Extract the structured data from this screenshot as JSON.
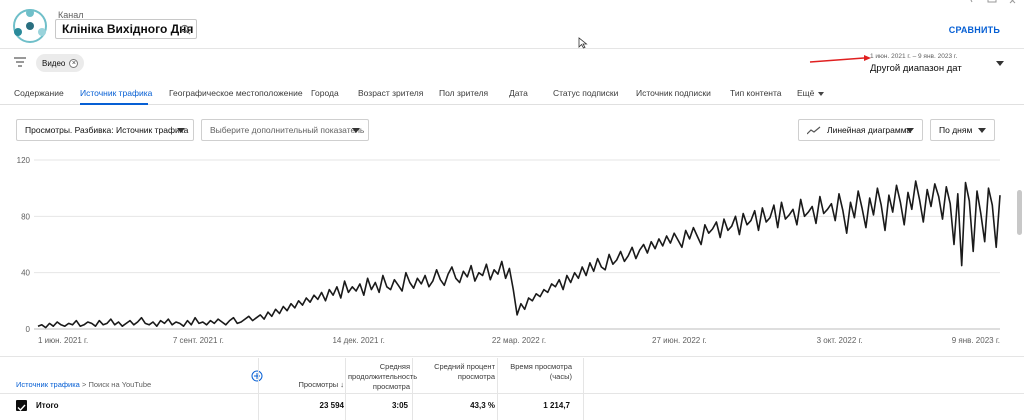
{
  "header": {
    "channel_label": "Канал",
    "channel_name": "Клініка Вихідного Дня",
    "compare": "СРАВНИТЬ"
  },
  "filters": {
    "chip_label": "Видео",
    "date_range": "1 июн. 2021 г. – 9 янв. 2023 г.",
    "date_preset": "Другой диапазон дат"
  },
  "tabs": [
    {
      "label": "Содержание"
    },
    {
      "label": "Источник трафика",
      "active": true
    },
    {
      "label": "Географическое местоположение"
    },
    {
      "label": "Города"
    },
    {
      "label": "Возраст зрителя"
    },
    {
      "label": "Пол зрителя"
    },
    {
      "label": "Дата"
    },
    {
      "label": "Статус подписки"
    },
    {
      "label": "Источник подписки"
    },
    {
      "label": "Тип контента"
    },
    {
      "label": "Ещё"
    }
  ],
  "selectors": {
    "metric": "Просмотры. Разбивка: Источник трафика",
    "extra_metric": "Выберите дополнительный показатель",
    "chart_type": "Линейная диаграмма",
    "interval": "По дням"
  },
  "chart_data": {
    "type": "line",
    "ylim": [
      0,
      120
    ],
    "yticks": [
      "0",
      "40",
      "80",
      "120"
    ],
    "xticks": [
      "1 июн. 2021 г.",
      "7 сент. 2021 г.",
      "14 дек. 2021 г.",
      "22 мар. 2022 г.",
      "27 июн. 2022 г.",
      "3 окт. 2022 г.",
      "9 янв. 2023 г."
    ],
    "series": [
      {
        "color": "#1a1a1a",
        "x_start": "2021-06-01",
        "x_end": "2023-01-09",
        "values": [
          2,
          3,
          1,
          4,
          2,
          5,
          3,
          2,
          4,
          3,
          6,
          2,
          3,
          5,
          4,
          2,
          6,
          3,
          4,
          7,
          3,
          5,
          2,
          4,
          6,
          3,
          5,
          8,
          4,
          3,
          5,
          2,
          6,
          4,
          7,
          3,
          5,
          4,
          2,
          6,
          3,
          8,
          4,
          5,
          3,
          6,
          4,
          7,
          5,
          3,
          6,
          8,
          4,
          5,
          7,
          9,
          6,
          8,
          10,
          7,
          12,
          9,
          14,
          11,
          16,
          13,
          18,
          15,
          20,
          17,
          22,
          19,
          24,
          21,
          26,
          20,
          28,
          24,
          30,
          22,
          34,
          26,
          30,
          27,
          32,
          24,
          36,
          28,
          33,
          26,
          38,
          30,
          28,
          35,
          31,
          27,
          40,
          33,
          29,
          36,
          32,
          38,
          30,
          34,
          42,
          35,
          31,
          39,
          44,
          36,
          33,
          41,
          37,
          45,
          34,
          40,
          38,
          46,
          35,
          42,
          39,
          48,
          36,
          43,
          28,
          10,
          18,
          14,
          22,
          20,
          25,
          23,
          28,
          26,
          32,
          30,
          35,
          28,
          38,
          33,
          40,
          36,
          44,
          38,
          47,
          41,
          50,
          44,
          42,
          53,
          46,
          49,
          55,
          48,
          52,
          58,
          50,
          56,
          60,
          54,
          62,
          57,
          64,
          59,
          66,
          61,
          68,
          63,
          58,
          70,
          64,
          72,
          66,
          60,
          74,
          68,
          71,
          76,
          65,
          78,
          70,
          73,
          80,
          67,
          82,
          74,
          77,
          84,
          70,
          86,
          76,
          79,
          88,
          72,
          90,
          78,
          81,
          85,
          74,
          92,
          80,
          83,
          87,
          75,
          94,
          82,
          85,
          89,
          77,
          96,
          84,
          68,
          90,
          79,
          98,
          86,
          72,
          93,
          81,
          100,
          88,
          70,
          95,
          83,
          102,
          90,
          74,
          97,
          85,
          105,
          92,
          76,
          99,
          87,
          103,
          94,
          78,
          101,
          89,
          60,
          96,
          45,
          104,
          91,
          55,
          98,
          82,
          62,
          100,
          88,
          58,
          95
        ]
      }
    ]
  },
  "table": {
    "breadcrumb_link": "Источник трафика",
    "breadcrumb_sep": ">",
    "breadcrumb_current": "Поиск на YouTube",
    "headers": {
      "views": "Просмотры",
      "avg_duration": "Средняя продолжительность просмотра",
      "avg_percent": "Средний процент просмотра",
      "watch_time": "Время просмотра (часы)"
    },
    "total": {
      "label": "Итого",
      "views": "23 594",
      "avg_duration": "3:05",
      "avg_percent": "43,3 %",
      "watch_time": "1 214,7"
    }
  }
}
